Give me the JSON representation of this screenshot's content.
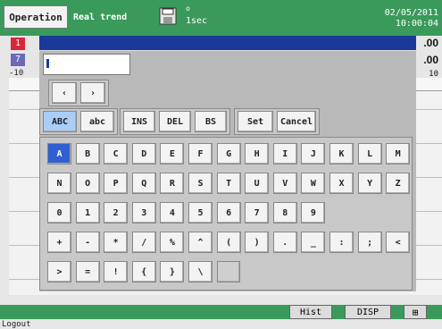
{
  "topbar": {
    "operation_label": "Operation",
    "mode_label": "Real trend",
    "record_indicator": "o",
    "interval": "1sec",
    "date": "02/05/2011",
    "time": "10:00:04",
    "disk_icon": "floppy-disk-icon",
    "bar_color": "#3a9a5b"
  },
  "channels": {
    "ch1": "1",
    "ch2": "7",
    "value1": ".00",
    "value2": ".00",
    "scale_left": "-10",
    "scale_right": "10"
  },
  "keyboard": {
    "input_value": "",
    "nav_left": "‹",
    "nav_right": "›",
    "mode_abc_upper": "ABC",
    "mode_abc_lower": "abc",
    "ins": "INS",
    "del": "DEL",
    "bs": "BS",
    "set": "Set",
    "cancel": "Cancel",
    "rows": [
      [
        "A",
        "B",
        "C",
        "D",
        "E",
        "F",
        "G",
        "H",
        "I",
        "J",
        "K",
        "L",
        "M"
      ],
      [
        "N",
        "O",
        "P",
        "Q",
        "R",
        "S",
        "T",
        "U",
        "V",
        "W",
        "X",
        "Y",
        "Z"
      ],
      [
        "0",
        "1",
        "2",
        "3",
        "4",
        "5",
        "6",
        "7",
        "8",
        "9"
      ],
      [
        "+",
        "-",
        "*",
        "/",
        "%",
        "^",
        "(",
        ")",
        ".",
        "_",
        ":",
        ";",
        "<"
      ],
      [
        ">",
        "=",
        "!",
        "{",
        "}",
        "\\",
        ""
      ]
    ],
    "selected_key": "A"
  },
  "bottombar": {
    "hist": "Hist",
    "disp": "DISP",
    "grid_icon": "grid-icon",
    "logout": "Logout"
  }
}
